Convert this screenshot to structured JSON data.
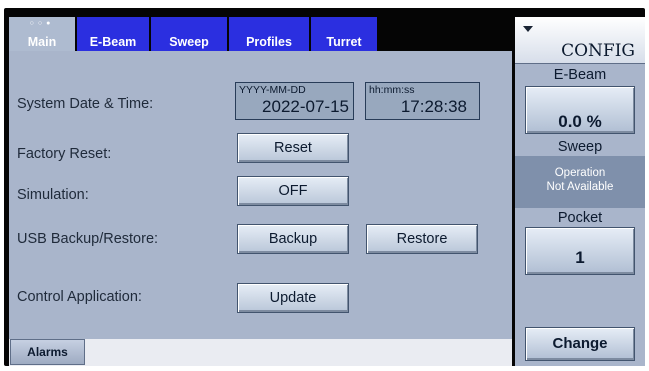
{
  "tabs": [
    {
      "label": "Main",
      "active": true
    },
    {
      "label": "E-Beam",
      "active": false
    },
    {
      "label": "Sweep",
      "active": false
    },
    {
      "label": "Profiles",
      "active": false
    },
    {
      "label": "Turret",
      "active": false
    }
  ],
  "rows": {
    "date_time": {
      "label": "System Date & Time:",
      "date_format": "YYYY-MM-DD",
      "date_value": "2022-07-15",
      "time_format": "hh:mm:ss",
      "time_value": "17:28:38"
    },
    "factory_reset": {
      "label": "Factory Reset:",
      "button": "Reset"
    },
    "simulation": {
      "label": "Simulation:",
      "button": "OFF"
    },
    "usb": {
      "label": "USB Backup/Restore:",
      "backup_button": "Backup",
      "restore_button": "Restore"
    },
    "control_app": {
      "label": "Control Application:",
      "button": "Update"
    }
  },
  "alarms_button": "Alarms",
  "side": {
    "config_label": "CONFIG",
    "ebeam_label": "E-Beam",
    "ebeam_value": "0.0 %",
    "sweep_label": "Sweep",
    "sweep_status_line1": "Operation",
    "sweep_status_line2": "Not Available",
    "pocket_label": "Pocket",
    "pocket_value": "1",
    "change_button": "Change"
  },
  "colors": {
    "tab_blue": "#2b2fe0",
    "panel_bg": "#a9b5cb",
    "side_panel_bg": "#a9b5cb",
    "status_bg": "#7f90ab"
  }
}
